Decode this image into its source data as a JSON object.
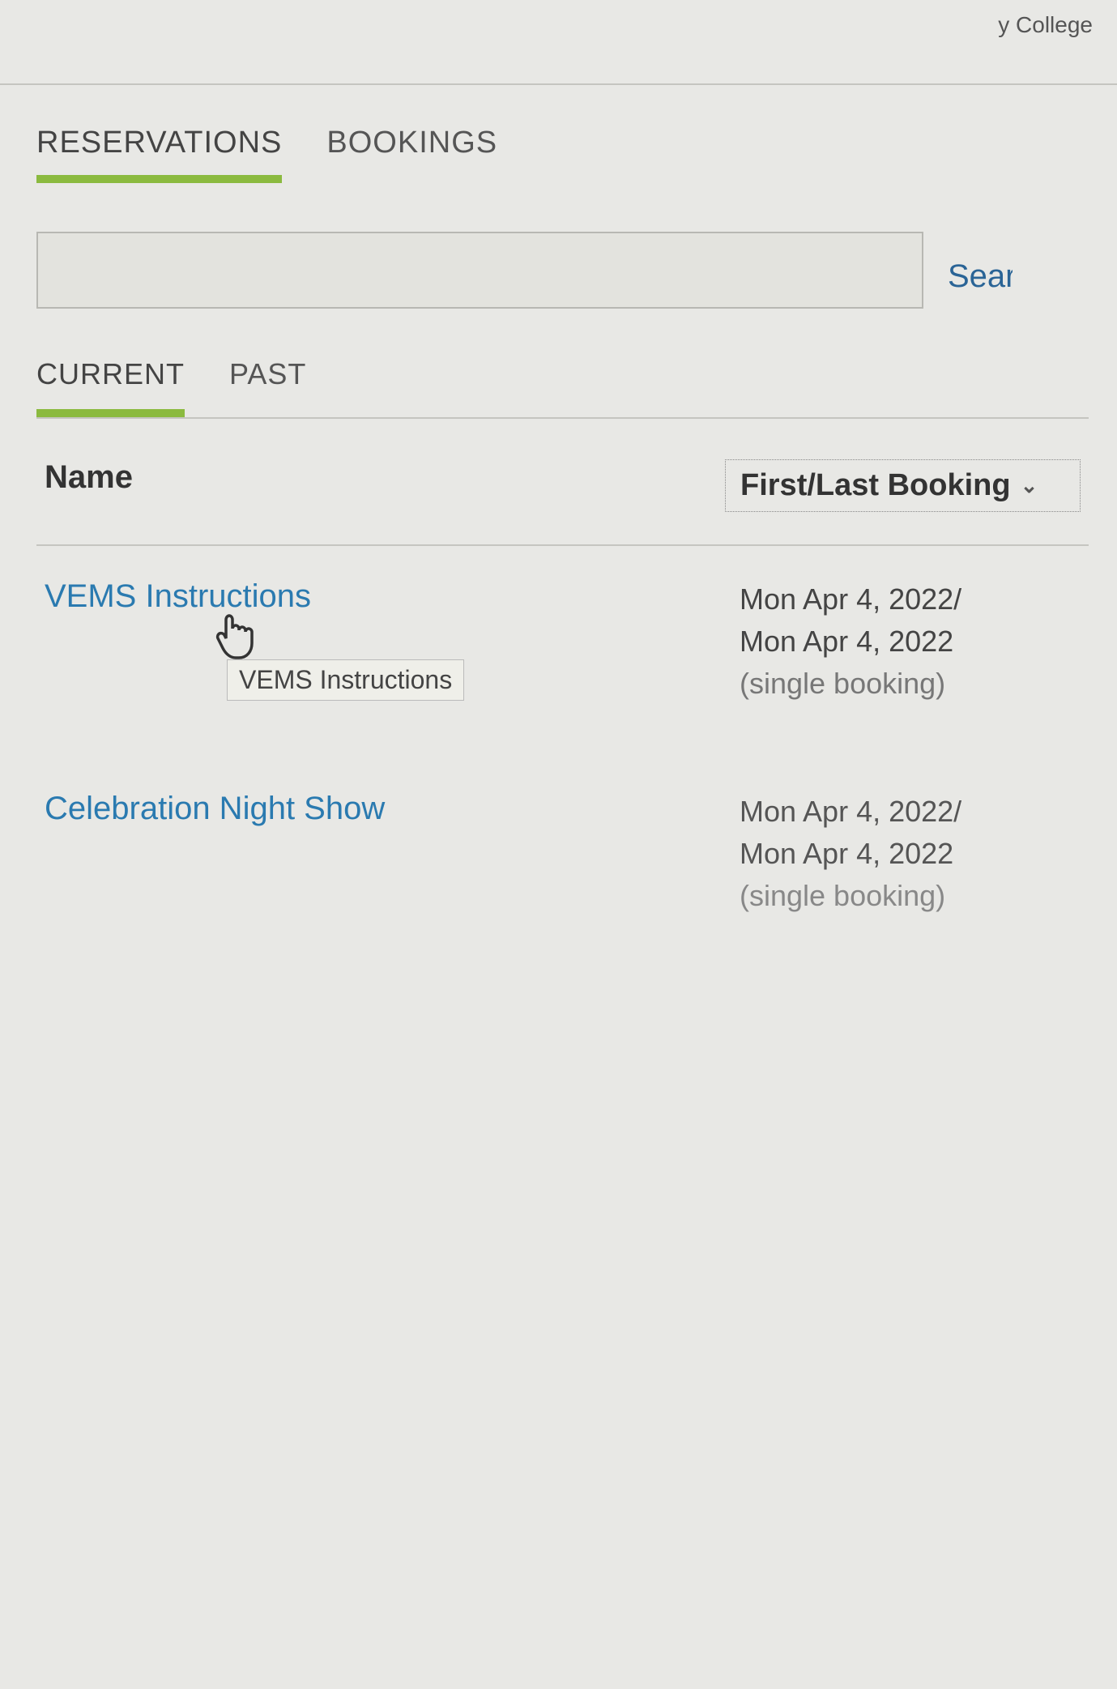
{
  "header": {
    "partial_text": "y College"
  },
  "topTabs": {
    "reservations": "RESERVATIONS",
    "bookings": "BOOKINGS"
  },
  "search": {
    "button_label": "Search",
    "value": ""
  },
  "subTabs": {
    "current": "CURRENT",
    "past": "PAST"
  },
  "columns": {
    "name": "Name",
    "booking": "First/Last Booking"
  },
  "rows": [
    {
      "name": "VEMS Instructions",
      "tooltip": "VEMS Instructions",
      "date1": "Mon Apr 4, 2022/",
      "date2": "Mon Apr 4, 2022",
      "note": "(single booking)"
    },
    {
      "name": "Celebration Night Show",
      "date1": "Mon Apr 4, 2022/",
      "date2": "Mon Apr 4, 2022",
      "note": "(single booking)"
    }
  ],
  "icons": {
    "chevron_down": "⌄",
    "cursor": "👆"
  }
}
